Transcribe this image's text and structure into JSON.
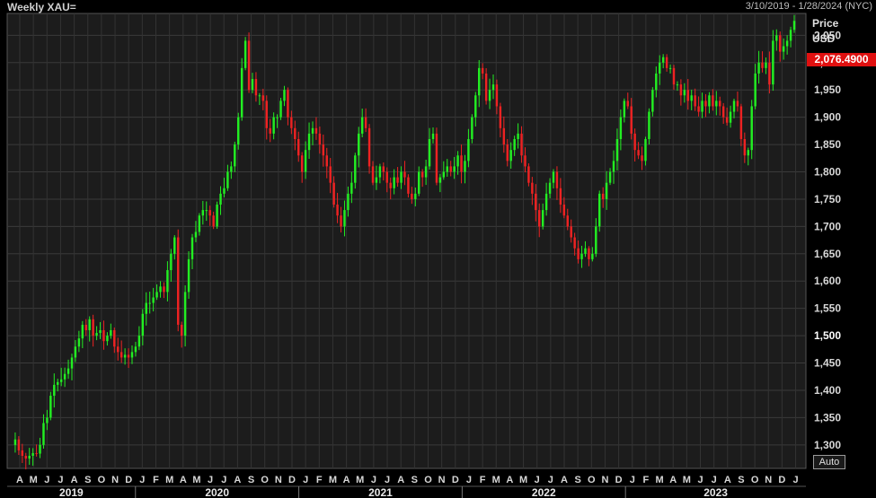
{
  "header": {
    "title": "Weekly XAU=",
    "date_range": "3/10/2019 - 1/28/2024 (NYC)"
  },
  "axis": {
    "price_label": "Price",
    "currency_label": "USD",
    "auto_label": "Auto"
  },
  "last_price_label": "2,076.4900",
  "colors": {
    "background": "#000000",
    "plot_background": "#1c1c1c",
    "grid": "#3a3a3a",
    "up": "#22ee22",
    "down": "#ee2222",
    "price_tag": "#e01010"
  },
  "chart_data": {
    "type": "candlestick",
    "yaxis": {
      "ylim": [
        1257,
        2090
      ],
      "ticks": [
        1300,
        1350,
        1400,
        1450,
        1500,
        1550,
        1600,
        1650,
        1700,
        1750,
        1800,
        1850,
        1900,
        1950,
        2000,
        2050
      ],
      "tick_labels": [
        "1,300",
        "1,350",
        "1,400",
        "1,450",
        "1,500",
        "1,550",
        "1,600",
        "1,650",
        "1,700",
        "1,750",
        "1,800",
        "1,850",
        "1,900",
        "1,950",
        "2,000",
        "2,050"
      ],
      "bold_tick": 1500
    },
    "xaxis": {
      "month_labels": [
        "A",
        "M",
        "J",
        "J",
        "A",
        "S",
        "O",
        "N",
        "D",
        "J",
        "F",
        "M",
        "A",
        "M",
        "J",
        "J",
        "A",
        "S",
        "O",
        "N",
        "D",
        "J",
        "F",
        "M",
        "A",
        "M",
        "J",
        "J",
        "A",
        "S",
        "O",
        "N",
        "D",
        "J",
        "F",
        "M",
        "A",
        "M",
        "J",
        "J",
        "A",
        "S",
        "O",
        "N",
        "D",
        "J",
        "F",
        "M",
        "A",
        "M",
        "J",
        "J",
        "A",
        "S",
        "O",
        "N",
        "D",
        "J"
      ],
      "years": [
        "2019",
        "2020",
        "2021",
        "2022",
        "2023"
      ],
      "grid": true
    },
    "last_price": 2076.49,
    "price_path": [
      1300,
      1310,
      1290,
      1280,
      1275,
      1280,
      1285,
      1284,
      1300,
      1340,
      1350,
      1390,
      1410,
      1415,
      1420,
      1430,
      1440,
      1460,
      1480,
      1495,
      1520,
      1510,
      1530,
      1500,
      1505,
      1510,
      1490,
      1500,
      1510,
      1480,
      1470,
      1460,
      1465,
      1460,
      1470,
      1480,
      1500,
      1540,
      1560,
      1560,
      1570,
      1580,
      1590,
      1580,
      1620,
      1650,
      1680,
      1520,
      1500,
      1580,
      1640,
      1680,
      1690,
      1720,
      1730,
      1730,
      1720,
      1700,
      1740,
      1760,
      1770,
      1800,
      1810,
      1850,
      1900,
      1990,
      2040,
      1950,
      1970,
      1940,
      1940,
      1930,
      1880,
      1870,
      1900,
      1900,
      1930,
      1950,
      1900,
      1880,
      1860,
      1830,
      1800,
      1840,
      1870,
      1880,
      1870,
      1850,
      1830,
      1810,
      1780,
      1740,
      1720,
      1700,
      1730,
      1760,
      1780,
      1830,
      1870,
      1900,
      1880,
      1810,
      1780,
      1790,
      1810,
      1800,
      1780,
      1770,
      1790,
      1780,
      1800,
      1790,
      1760,
      1750,
      1760,
      1800,
      1790,
      1810,
      1860,
      1870,
      1780,
      1790,
      1800,
      1810,
      1800,
      1810,
      1830,
      1800,
      1820,
      1860,
      1900,
      1940,
      1990,
      1980,
      1930,
      1950,
      1960,
      1920,
      1880,
      1850,
      1820,
      1840,
      1860,
      1870,
      1830,
      1810,
      1780,
      1760,
      1730,
      1700,
      1730,
      1760,
      1780,
      1800,
      1770,
      1740,
      1720,
      1700,
      1680,
      1660,
      1640,
      1650,
      1660,
      1640,
      1650,
      1700,
      1760,
      1750,
      1780,
      1800,
      1820,
      1860,
      1900,
      1930,
      1920,
      1870,
      1840,
      1830,
      1820,
      1860,
      1910,
      1950,
      1980,
      2000,
      2010,
      1990,
      1990,
      1960,
      1960,
      1940,
      1950,
      1930,
      1940,
      1920,
      1910,
      1930,
      1920,
      1940,
      1920,
      1930,
      1920,
      1900,
      1890,
      1910,
      1930,
      1920,
      1860,
      1830,
      1840,
      1920,
      1980,
      2000,
      1990,
      2000,
      1960,
      2040,
      2050,
      2020,
      2030,
      2040,
      2060,
      2076.49
    ]
  }
}
